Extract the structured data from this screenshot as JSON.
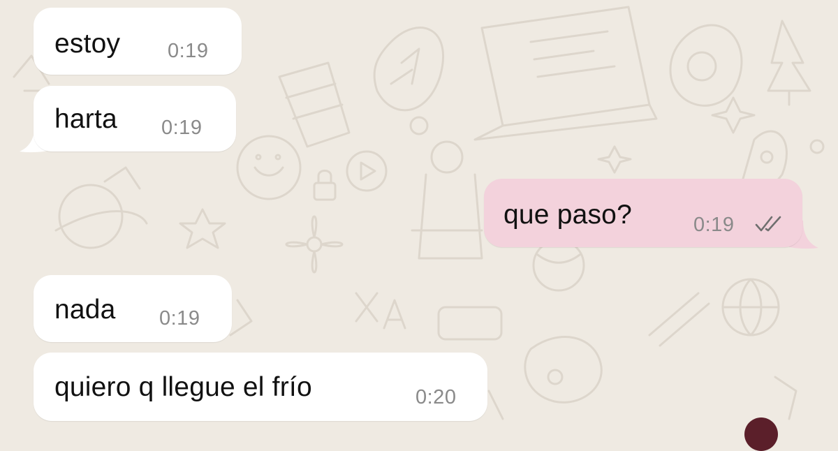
{
  "chat": {
    "messages": [
      {
        "direction": "incoming",
        "text": "estoy",
        "time": "0:19"
      },
      {
        "direction": "incoming",
        "text": "harta",
        "time": "0:19"
      },
      {
        "direction": "outgoing",
        "text": "que paso?",
        "time": "0:19",
        "status": "read"
      },
      {
        "direction": "incoming",
        "text": "nada",
        "time": "0:19"
      },
      {
        "direction": "incoming",
        "text": "quiero q llegue el frío",
        "time": "0:20"
      }
    ]
  },
  "colors": {
    "background": "#efeae2",
    "incoming_bubble": "#ffffff",
    "outgoing_bubble": "#f3d2dc",
    "time_text": "#8a8a8a",
    "wallpaper_doodle": "#ddd6cc",
    "scroll_badge": "#5b1f2a"
  },
  "icons": {
    "read_receipt": "double-check-icon"
  }
}
